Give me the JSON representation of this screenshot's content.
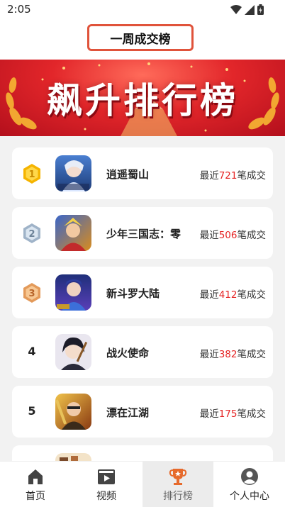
{
  "status": {
    "time": "2:05"
  },
  "header": {
    "title": "一周成交榜"
  },
  "banner": {
    "title": "飙升排行榜"
  },
  "list": {
    "prefix": "最近",
    "suffix": "笔成交",
    "items": [
      {
        "rank": "1",
        "name": "逍遥蜀山",
        "count": "721",
        "icon": "xiaoyao-shushan-game-icon"
      },
      {
        "rank": "2",
        "name": "少年三国志：零",
        "count": "506",
        "icon": "shaonian-sanguozhi-game-icon"
      },
      {
        "rank": "3",
        "name": "新斗罗大陆",
        "count": "412",
        "icon": "xin-douluo-dalu-game-icon"
      },
      {
        "rank": "4",
        "name": "战火使命",
        "count": "382",
        "icon": "zhanhuo-shiming-game-icon"
      },
      {
        "rank": "5",
        "name": "漂在江湖",
        "count": "175",
        "icon": "piaozai-jianghu-game-icon"
      }
    ]
  },
  "tabs": [
    {
      "label": "首页",
      "icon": "home-icon"
    },
    {
      "label": "视频",
      "icon": "video-icon"
    },
    {
      "label": "排行榜",
      "icon": "trophy-icon"
    },
    {
      "label": "个人中心",
      "icon": "profile-icon"
    }
  ],
  "colors": {
    "accent": "#e0533b",
    "count": "#e52424",
    "banner": "#e2262a",
    "gold": "#f5b400"
  }
}
